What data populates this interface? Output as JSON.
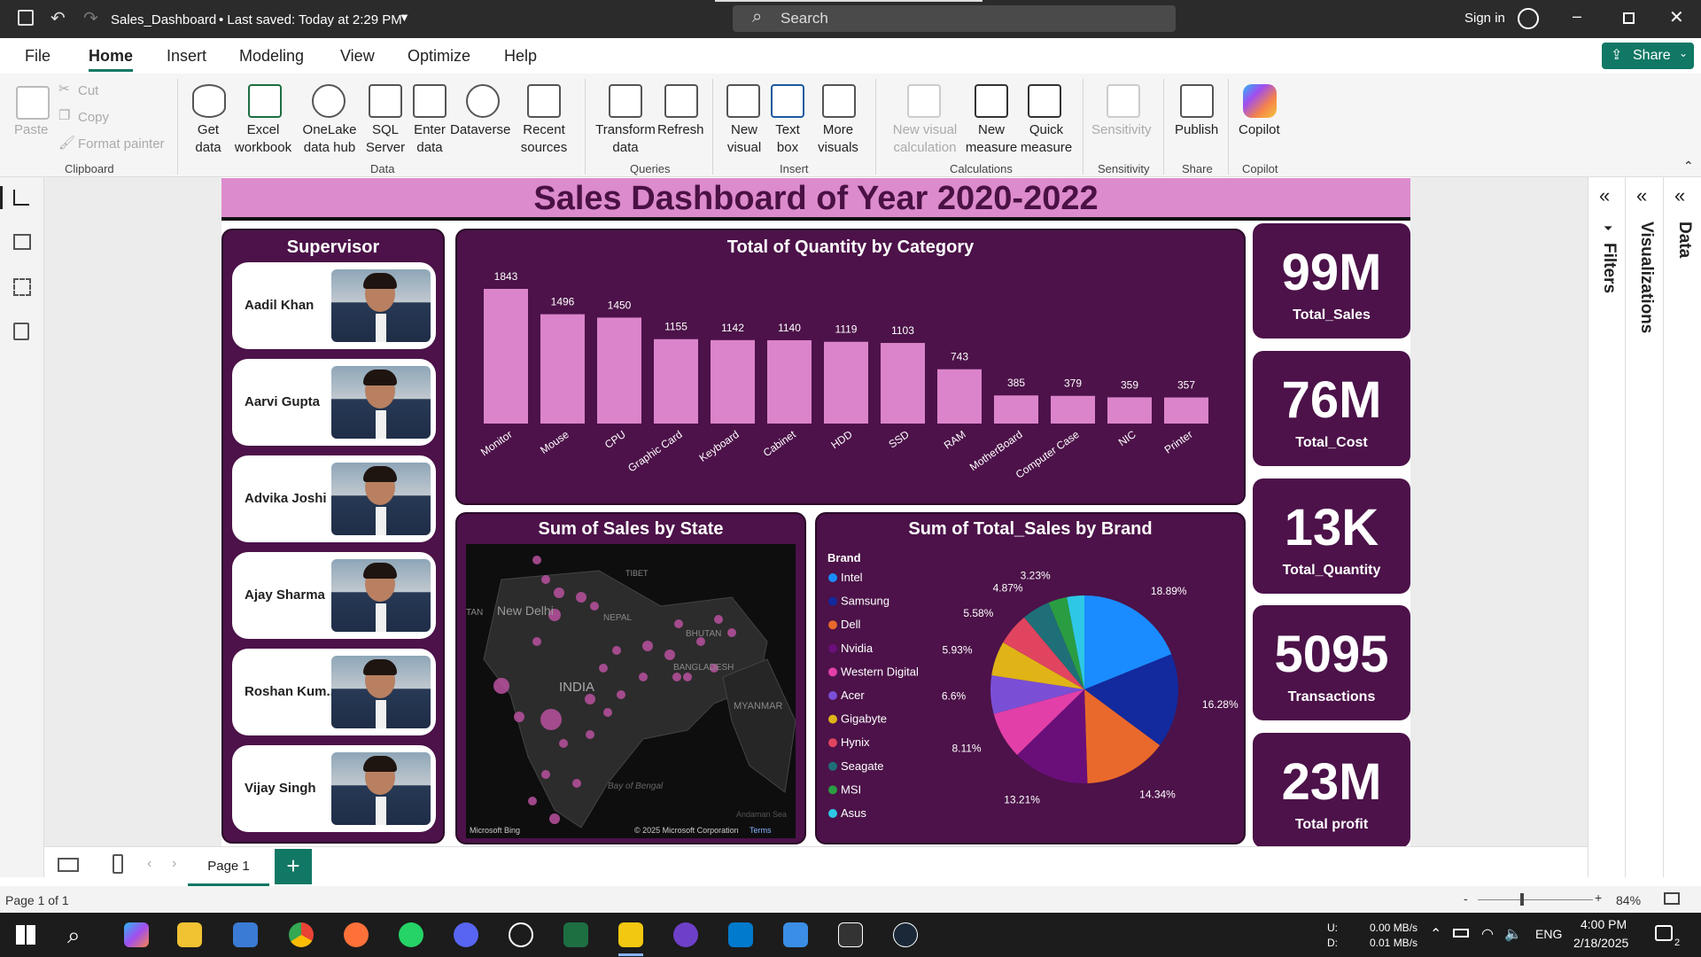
{
  "window": {
    "file_title": "Sales_Dashboard",
    "saved": "• Last saved: Today at 2:29 PM",
    "search_placeholder": "Search",
    "sign_in": "Sign in"
  },
  "menu": {
    "items": [
      "File",
      "Home",
      "Insert",
      "Modeling",
      "View",
      "Optimize",
      "Help"
    ],
    "share": "Share"
  },
  "ribbon": {
    "clipboard": {
      "paste": "Paste",
      "cut": "Cut",
      "copy": "Copy",
      "format_painter": "Format painter",
      "group": "Clipboard"
    },
    "data": {
      "get_data": "Get data",
      "excel": "Excel workbook",
      "onelake": "OneLake data hub",
      "sql": "SQL Server",
      "enter_data": "Enter data",
      "dataverse": "Dataverse",
      "recent": "Recent sources",
      "group": "Data"
    },
    "queries": {
      "transform": "Transform data",
      "refresh": "Refresh",
      "group": "Queries"
    },
    "insert": {
      "new_visual": "New visual",
      "text_box": "Text box",
      "more_visuals": "More visuals",
      "group": "Insert"
    },
    "calculations": {
      "new_visual_calc": "New visual calculation",
      "new_measure": "New measure",
      "quick_measure": "Quick measure",
      "group": "Calculations"
    },
    "sensitivity": {
      "label": "Sensitivity",
      "group": "Sensitivity"
    },
    "share": {
      "publish": "Publish",
      "group": "Share"
    },
    "copilot": {
      "label": "Copilot",
      "group": "Copilot"
    }
  },
  "dashboard": {
    "title": "Sales Dashboard of Year 2020-2022"
  },
  "supervisor": {
    "title": "Supervisor",
    "names": [
      "Aadil Khan",
      "Aarvi Gupta",
      "Advika Joshi",
      "Ajay Sharma",
      "Roshan Kum...",
      "Vijay Singh"
    ]
  },
  "kpis": [
    {
      "value": "99M",
      "label": "Total_Sales"
    },
    {
      "value": "76M",
      "label": "Total_Cost"
    },
    {
      "value": "13K",
      "label": "Total_Quantity"
    },
    {
      "value": "5095",
      "label": "Transactions"
    },
    {
      "value": "23M",
      "label": "Total profit"
    }
  ],
  "map": {
    "title": "Sum of Sales by State",
    "labels": [
      "TIBET",
      "New Delhi",
      "NEPAL",
      "BHUTAN",
      "BANGLADESH",
      "INDIA",
      "MYANMAR",
      "Bay of Bengal",
      "Andaman Sea",
      "TAN"
    ],
    "bing": "Microsoft Bing",
    "copyright": "© 2025 Microsoft Corporation",
    "terms": "Terms"
  },
  "pie_legend_title": "Brand",
  "chart_data": [
    {
      "type": "bar",
      "title": "Total of Quantity by Category",
      "categories": [
        "Monitor",
        "Mouse",
        "CPU",
        "Graphic Card",
        "Keyboard",
        "Cabinet",
        "HDD",
        "SSD",
        "RAM",
        "MotherBoard",
        "Computer Case",
        "NIC",
        "Printer"
      ],
      "values": [
        1843,
        1496,
        1450,
        1155,
        1142,
        1140,
        1119,
        1103,
        743,
        385,
        379,
        359,
        357
      ],
      "color": "#db84cb",
      "ylim": [
        0,
        1843
      ]
    },
    {
      "type": "pie",
      "title": "Sum of Total_Sales by Brand",
      "categories": [
        "Intel",
        "Samsung",
        "Dell",
        "Nvidia",
        "Western Digital",
        "Acer",
        "Gigabyte",
        "Hynix",
        "Seagate",
        "MSI",
        "Asus"
      ],
      "values": [
        18.89,
        16.28,
        14.34,
        13.21,
        8.11,
        6.6,
        5.93,
        5.58,
        4.87,
        3.23,
        3.0
      ],
      "labels": [
        "18.89%",
        "16.28%",
        "14.34%",
        "13.21%",
        "8.11%",
        "6.6%",
        "5.93%",
        "5.58%",
        "4.87%",
        "3.23%",
        ""
      ],
      "colors": [
        "#1a8cff",
        "#122a9e",
        "#e8692b",
        "#6a0f7a",
        "#e23fa8",
        "#7a4fd6",
        "#e0b417",
        "#e0445e",
        "#1f6f78",
        "#2a9d42",
        "#2ec8e6"
      ],
      "legend": "left"
    }
  ],
  "pages": {
    "current": "Page 1",
    "status": "Page 1 of 1",
    "zoom": "84%"
  },
  "panes": {
    "filters": "Filters",
    "visualizations": "Visualizations",
    "data": "Data"
  },
  "taskbar": {
    "net_up_label": "U:",
    "net_down_label": "D:",
    "net_up": "0.00 MB/s",
    "net_down": "0.01 MB/s",
    "lang": "ENG",
    "time": "4:00 PM",
    "date": "2/18/2025",
    "notif": "2"
  }
}
